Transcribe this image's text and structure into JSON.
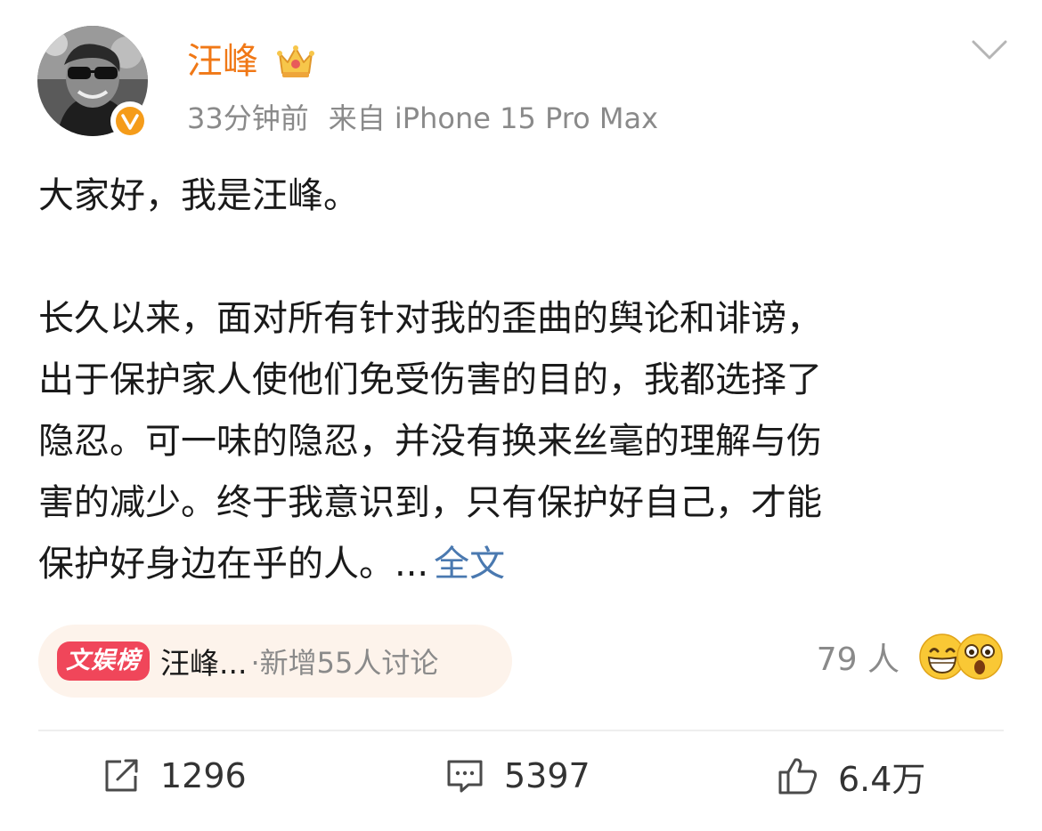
{
  "author": {
    "name": "汪峰",
    "avatar_icon": "portrait-avatar",
    "verified_icon": "verified-badge-icon",
    "vip_icon": "crown-icon"
  },
  "meta": {
    "time": "33分钟前",
    "source": "来自 iPhone 15 Pro Max"
  },
  "post": {
    "greeting": "大家好，我是汪峰。",
    "lines": [
      "长久以来，面对所有针对我的歪曲的舆论和诽谤，",
      "出于保护家人使他们免受伤害的目的，我都选择了",
      "隐忍。可一味的隐忍，并没有换来丝毫的理解与伤",
      "害的减少。终于我意识到，只有保护好自己，才能",
      "保护好身边在乎的人。..."
    ],
    "full_text_label": "全文"
  },
  "topic": {
    "tag": "文娱榜",
    "title": "汪峰...",
    "extra": "·新增55人讨论"
  },
  "reactions": {
    "count": "79 人",
    "icons": [
      "grin-emoji-icon",
      "shocked-emoji-icon"
    ]
  },
  "actions": {
    "repost": "1296",
    "comment": "5397",
    "like": "6.4万"
  },
  "colors": {
    "username": "#f07816",
    "link": "#4a79b0",
    "tag": "#f0465a",
    "meta": "#8a8a8a"
  }
}
